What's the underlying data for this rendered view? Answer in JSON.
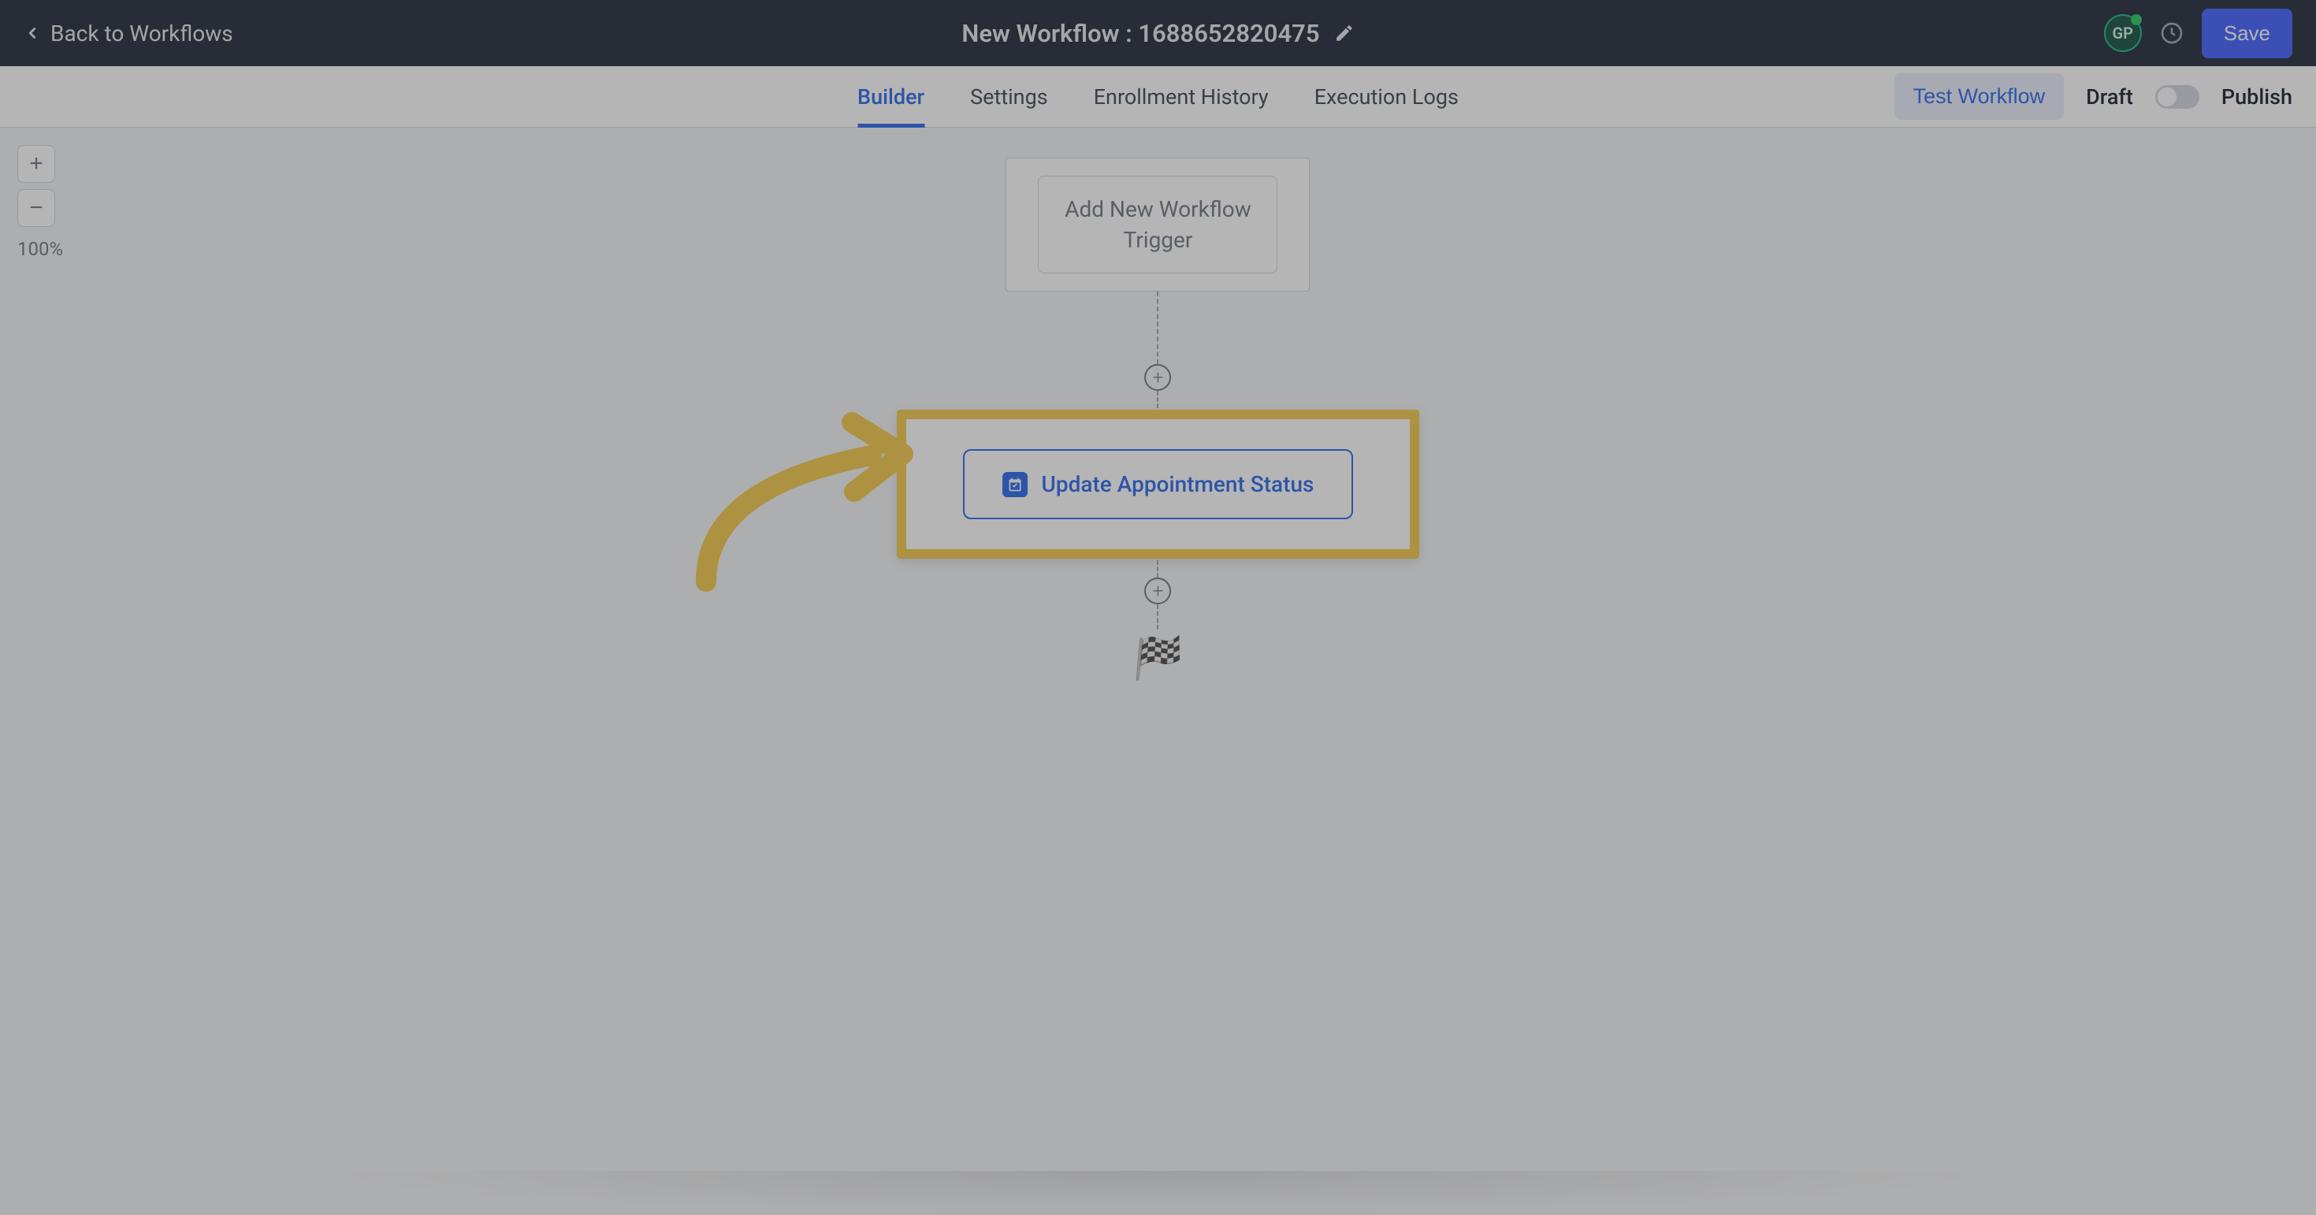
{
  "header": {
    "back_label": "Back to Workflows",
    "title": "New Workflow : 1688652820475",
    "avatar_initials": "GP",
    "save_label": "Save"
  },
  "tabs": {
    "items": [
      "Builder",
      "Settings",
      "Enrollment History",
      "Execution Logs"
    ],
    "active_index": 0,
    "test_label": "Test Workflow",
    "draft_label": "Draft",
    "publish_label": "Publish"
  },
  "zoom": {
    "plus": "+",
    "minus": "−",
    "level": "100%"
  },
  "flow": {
    "trigger_label": "Add New Workflow Trigger",
    "action_label": "Update Appointment Status",
    "end_icon": "🏁"
  }
}
